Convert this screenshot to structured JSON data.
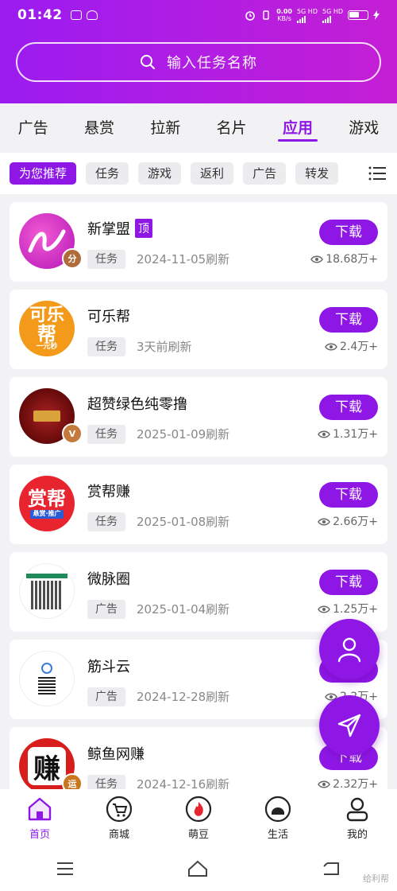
{
  "status_bar": {
    "time": "01:42",
    "speed_value": "0.00",
    "speed_unit": "KB/s",
    "net1": "5G HD",
    "net2": "5G HD"
  },
  "search": {
    "placeholder": "输入任务名称"
  },
  "tabs": [
    "广告",
    "悬赏",
    "拉新",
    "名片",
    "应用",
    "游戏"
  ],
  "active_tab": "应用",
  "chips": [
    "为您推荐",
    "任务",
    "游戏",
    "返利",
    "广告",
    "转发"
  ],
  "items": [
    {
      "name": "新掌盟",
      "tag": "顶",
      "category": "任务",
      "date": "2024-11-05刷新",
      "views": "18.68万+",
      "button": "下载",
      "badge": "分"
    },
    {
      "name": "可乐帮",
      "category": "任务",
      "date": "3天前刷新",
      "views": "2.4万+",
      "button": "下载",
      "logo_text": [
        "可乐",
        "帮",
        "一元秒"
      ]
    },
    {
      "name": "超赞绿色纯零撸",
      "category": "任务",
      "date": "2025-01-09刷新",
      "views": "1.31万+",
      "button": "下载",
      "badge": "V"
    },
    {
      "name": "赏帮赚",
      "category": "任务",
      "date": "2025-01-08刷新",
      "views": "2.66万+",
      "button": "下载",
      "logo_text": [
        "赏帮",
        "悬赏·推广"
      ]
    },
    {
      "name": "微脉圈",
      "category": "广告",
      "date": "2025-01-04刷新",
      "views": "1.25万+",
      "button": "下载"
    },
    {
      "name": "筋斗云",
      "category": "广告",
      "date": "2024-12-28刷新",
      "views": "2.2万+",
      "button": "下载"
    },
    {
      "name": "鲸鱼网赚",
      "category": "任务",
      "date": "2024-12-16刷新",
      "views": "2.32万+",
      "button": "下载",
      "badge": "运",
      "logo_text": [
        "赚"
      ]
    }
  ],
  "bottom_tabs": [
    "首页",
    "商城",
    "萌豆",
    "生活",
    "我的"
  ],
  "watermark": "给利帮",
  "colors": {
    "accent": "#8e17e6",
    "header_start": "#9a1bf0",
    "header_end": "#c41fd4"
  }
}
